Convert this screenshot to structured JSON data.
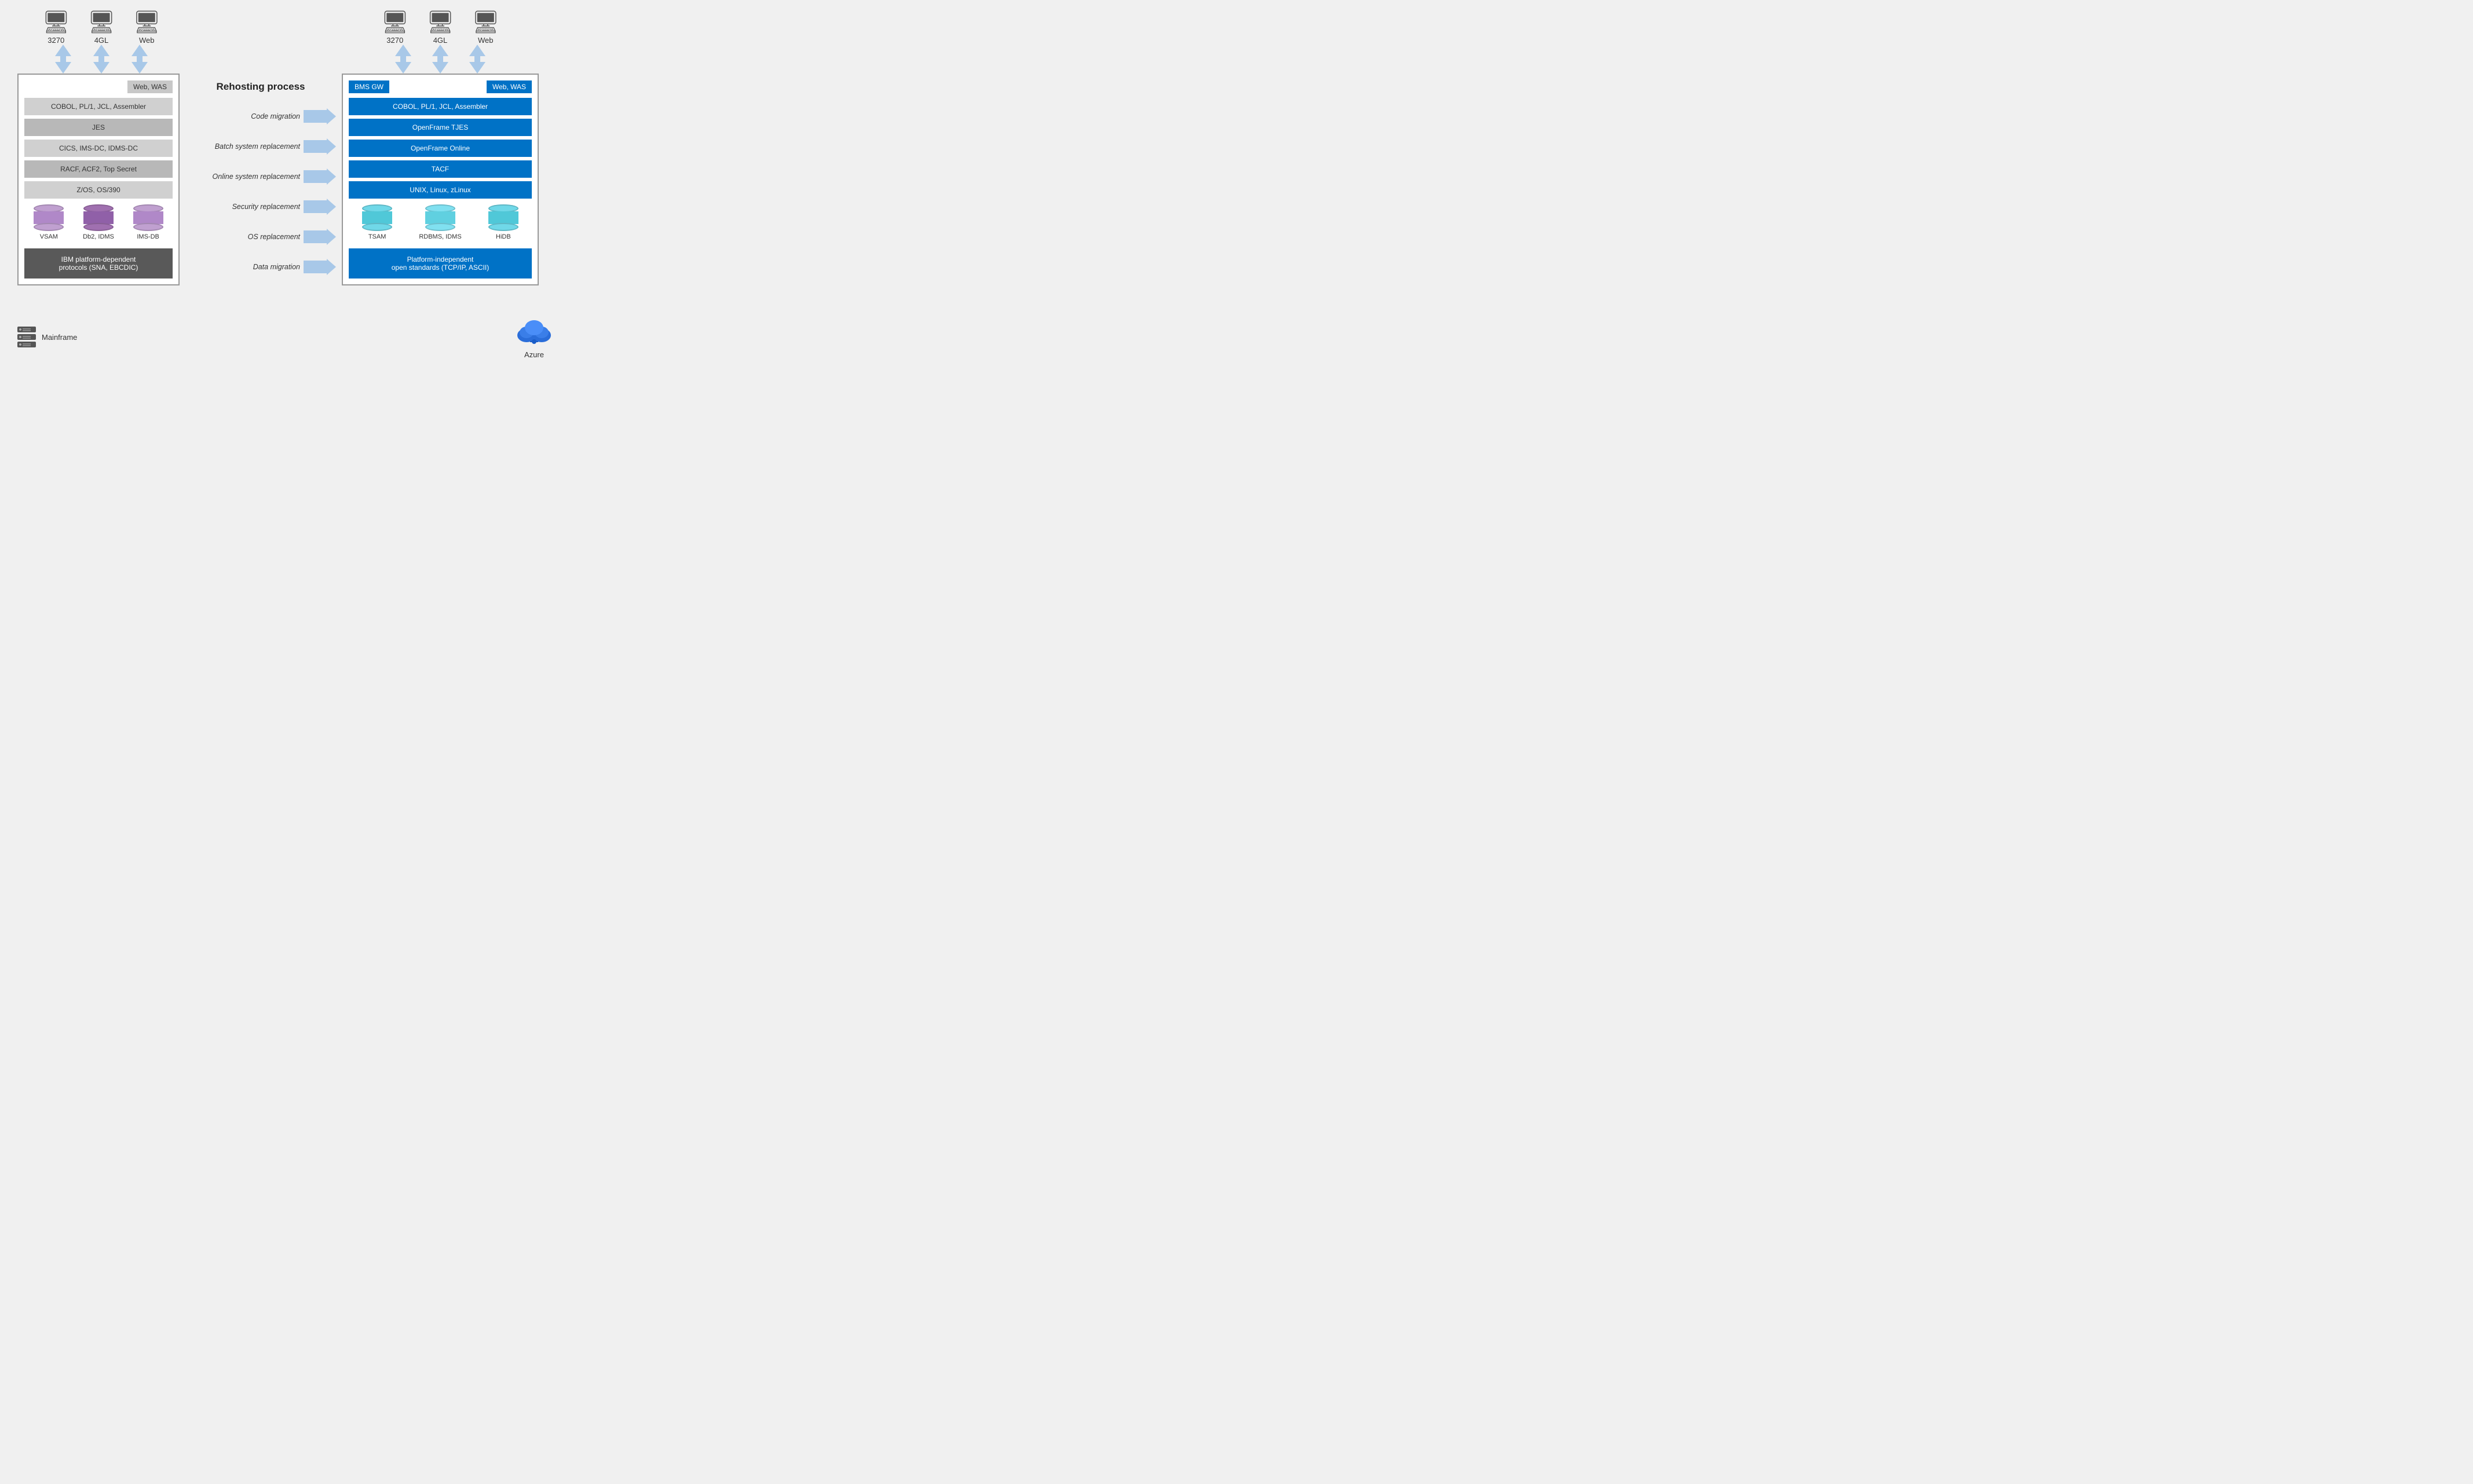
{
  "left": {
    "terminals": [
      {
        "label": "3270"
      },
      {
        "label": "4GL"
      },
      {
        "label": "Web"
      }
    ],
    "web_was": "Web, WAS",
    "bars": [
      "COBOL, PL/1, JCL, Assembler",
      "JES",
      "CICS, IMS-DC, IDMS-DC",
      "RACF, ACF2, Top Secret",
      "Z/OS, OS/390"
    ],
    "databases": [
      {
        "label": "VSAM",
        "color": "purple"
      },
      {
        "label": "Db2, IDMS",
        "color": "purple2"
      },
      {
        "label": "IMS-DB",
        "color": "purple"
      }
    ],
    "bottom_box": "IBM platform-dependent\nprotocols (SNA, EBCDIC)"
  },
  "center": {
    "title": "Rehosting process",
    "processes": [
      "Code migration",
      "Batch system replacement",
      "Online system replacement",
      "Security replacement",
      "OS replacement",
      "Data migration"
    ]
  },
  "right": {
    "terminals": [
      {
        "label": "3270"
      },
      {
        "label": "4GL"
      },
      {
        "label": "Web"
      }
    ],
    "bms_gw": "BMS GW",
    "web_was": "Web, WAS",
    "bars": [
      "COBOL, PL/1, JCL, Assembler",
      "OpenFrame TJES",
      "OpenFrame Online",
      "TACF",
      "UNIX, Linux, zLinux"
    ],
    "databases": [
      {
        "label": "TSAM",
        "color": "cyan"
      },
      {
        "label": "RDBMS, IDMS",
        "color": "cyan2"
      },
      {
        "label": "HiDB",
        "color": "cyan"
      }
    ],
    "bottom_box": "Platform-independent\nopen standards (TCP/IP, ASCII)"
  },
  "bottom": {
    "mainframe_label": "Mainframe",
    "azure_label": "Azure"
  }
}
